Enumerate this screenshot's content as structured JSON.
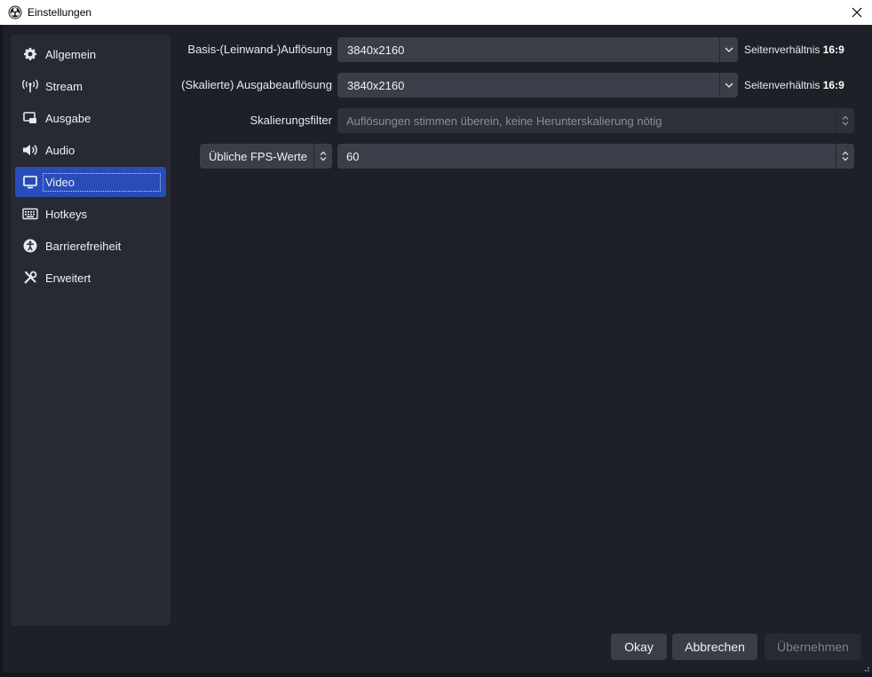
{
  "window": {
    "title": "Einstellungen",
    "app_icon": "obs-logo-icon",
    "close_icon": "close-icon"
  },
  "sidebar": {
    "items": [
      {
        "label": "Allgemein",
        "icon": "gear-icon"
      },
      {
        "label": "Stream",
        "icon": "broadcast-icon"
      },
      {
        "label": "Ausgabe",
        "icon": "output-icon"
      },
      {
        "label": "Audio",
        "icon": "speaker-icon"
      },
      {
        "label": "Video",
        "icon": "monitor-icon",
        "active": true
      },
      {
        "label": "Hotkeys",
        "icon": "keyboard-icon"
      },
      {
        "label": "Barrierefreiheit",
        "icon": "accessibility-icon"
      },
      {
        "label": "Erweitert",
        "icon": "tools-icon"
      }
    ]
  },
  "video": {
    "base_resolution": {
      "label": "Basis-(Leinwand-)Auflösung",
      "value": "3840x2160",
      "aspect_prefix": "Seitenverhältnis",
      "aspect_value": "16:9"
    },
    "output_resolution": {
      "label": "(Skalierte) Ausgabeauflösung",
      "value": "3840x2160",
      "aspect_prefix": "Seitenverhältnis",
      "aspect_value": "16:9"
    },
    "scale_filter": {
      "label": "Skalierungsfilter",
      "value": "Auflösungen stimmen überein, keine Herunterskalierung nötig"
    },
    "fps": {
      "type_value": "Übliche FPS-Werte",
      "value": "60"
    }
  },
  "buttons": {
    "ok": "Okay",
    "cancel": "Abbrechen",
    "apply": "Übernehmen"
  },
  "colors": {
    "active_nav": "#284cb8",
    "background": "#1e2028",
    "panel": "#272a33",
    "control": "#3b3e48"
  }
}
